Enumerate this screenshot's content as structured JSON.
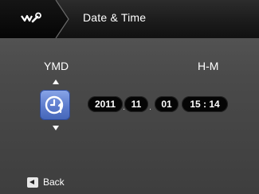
{
  "header": {
    "menu_icon": "settings-wrench-icon",
    "title": "Date & Time"
  },
  "labels": {
    "date_format": "YMD",
    "time_format": "H-M"
  },
  "timezone": {
    "icon": "world-time-clock-icon"
  },
  "fields": {
    "year": "2011",
    "month": "11",
    "day": "01",
    "time": "15 : 14"
  },
  "separators": {
    "date_sep_1": ".",
    "date_sep_2": "."
  },
  "footer": {
    "back_icon": "back-arrow-icon",
    "back_label": "Back"
  },
  "colors": {
    "accent": "#5d7ccd",
    "background": "#4a4a4a",
    "titlebar": "#1a1a1a"
  }
}
